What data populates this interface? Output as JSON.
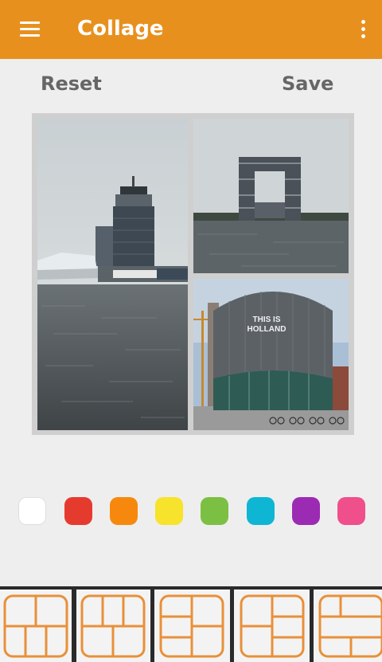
{
  "app_bar": {
    "title": "Collage",
    "menu_icon": "hamburger-menu-icon",
    "overflow_icon": "more-vert-icon",
    "color": "#e8901e"
  },
  "actions": {
    "reset_label": "Reset",
    "save_label": "Save"
  },
  "collage": {
    "layout": "one-left-two-right",
    "photos": [
      "harbor-tower-photo",
      "gate-building-photo",
      "round-building-photo"
    ],
    "photo_caption": "THIS IS\nHOLLAND"
  },
  "colors": [
    "#ffffff",
    "#e53b2f",
    "#f6890d",
    "#f7e32b",
    "#7cc043",
    "#0fb6d3",
    "#9b2bb3",
    "#ef4f8a"
  ],
  "layouts": [
    "layout-grid-1",
    "layout-grid-2",
    "layout-grid-3",
    "layout-grid-4",
    "layout-grid-5"
  ]
}
